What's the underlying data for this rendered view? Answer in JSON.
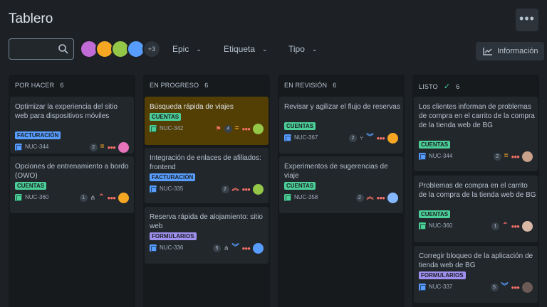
{
  "header": {
    "title": "Tablero",
    "more_label": "•••"
  },
  "toolbar": {
    "search_placeholder": "",
    "avatars_more": "+3",
    "filters": [
      {
        "label": "Epic"
      },
      {
        "label": "Etiqueta"
      },
      {
        "label": "Tipo"
      }
    ],
    "info_label": "Información"
  },
  "columns": [
    {
      "name": "POR HACER",
      "count": "6",
      "done": false,
      "cards": [
        {
          "title": "Optimizar la experiencia del sitio web para dispositivos móviles",
          "tag": "FACTURACIÓN",
          "tag_type": "fact",
          "type": "task",
          "key": "NUC-344",
          "count": "2",
          "priority": "medium",
          "avatar_color": "#e774bb",
          "selected": false
        },
        {
          "title": "Opciones de entrenamiento a bordo (OWO)",
          "tag": "CUENTAS",
          "tag_type": "cuen",
          "type": "story",
          "key": "NUC-360",
          "count": "1",
          "priority": "high",
          "subtasks": true,
          "avatar_color": "#f5a623",
          "selected": false
        }
      ]
    },
    {
      "name": "EN PROGRESO",
      "count": "6",
      "done": false,
      "cards": [
        {
          "title": "Búsqueda rápida de viajes",
          "tag": "CUENTAS",
          "tag_type": "cuen",
          "type": "story",
          "key": "NUC-342",
          "count": "4",
          "priority": "medium",
          "flag": true,
          "avatar_color": "#94c748",
          "selected": true
        },
        {
          "title": "Integración de enlaces de afiliados: frontend",
          "tag": "FACTURACIÓN",
          "tag_type": "fact",
          "type": "task",
          "key": "NUC-335",
          "count": "2",
          "priority": "highest",
          "avatar_color": "#94c748",
          "selected": false
        },
        {
          "title": "Reserva rápida de alojamiento: sitio web",
          "tag": "FORMULARIOS",
          "tag_type": "form",
          "type": "task",
          "key": "NUC-336",
          "count": "5",
          "priority": "lowest",
          "subtasks": true,
          "avatar_color": "#579dff",
          "selected": false
        }
      ]
    },
    {
      "name": "EN REVISIÓN",
      "count": "6",
      "done": false,
      "cards": [
        {
          "title": "Revisar y agilizar el flujo de reservas",
          "tag": "CUENTAS",
          "tag_type": "cuen",
          "type": "task",
          "key": "NUC-367",
          "count": "2",
          "priority": "lowest",
          "branch": true,
          "avatar_color": "#f5a623",
          "selected": false
        },
        {
          "title": "Experimentos de sugerencias de viaje",
          "tag": "CUENTAS",
          "tag_type": "cuen",
          "type": "story",
          "key": "NUC-358",
          "count": "2",
          "priority": "highest",
          "avatar_color": "#85b8ff",
          "selected": false
        }
      ]
    },
    {
      "name": "LISTO",
      "count": "6",
      "done": true,
      "cards": [
        {
          "title": "Los clientes informan de problemas de compra en el carrito de la compra de la tienda web de BG",
          "tag": "CUENTAS",
          "tag_type": "cuen",
          "type": "task",
          "key": "NUC-344",
          "count": "2",
          "priority": "medium",
          "avatar_color": "#c9a18a",
          "selected": false
        },
        {
          "title": "Problemas de compra en el carrito de la compra de la tienda web de BG",
          "tag": "CUENTAS",
          "tag_type": "cuen",
          "type": "story",
          "key": "NUC-360",
          "count": "1",
          "priority": "high",
          "avatar_color": "#d9b8a6",
          "selected": false
        },
        {
          "title": "Corregir bloqueo de la aplicación de tienda web de BG",
          "tag": "FORMULARIOS",
          "tag_type": "form",
          "type": "task",
          "key": "NUC-337",
          "count": "5",
          "priority": "lowest",
          "avatar_color": "#6b5a55",
          "selected": false
        }
      ]
    }
  ],
  "colors": {
    "background": "#1d2125",
    "card": "#22272b",
    "card_selected": "#533f04",
    "tag_facturacion": "#579dff",
    "tag_cuentas": "#4bce97",
    "tag_formularios": "#9f8fef",
    "priority_high": "#f87168",
    "priority_medium": "#f5a623",
    "priority_low": "#579dff"
  }
}
